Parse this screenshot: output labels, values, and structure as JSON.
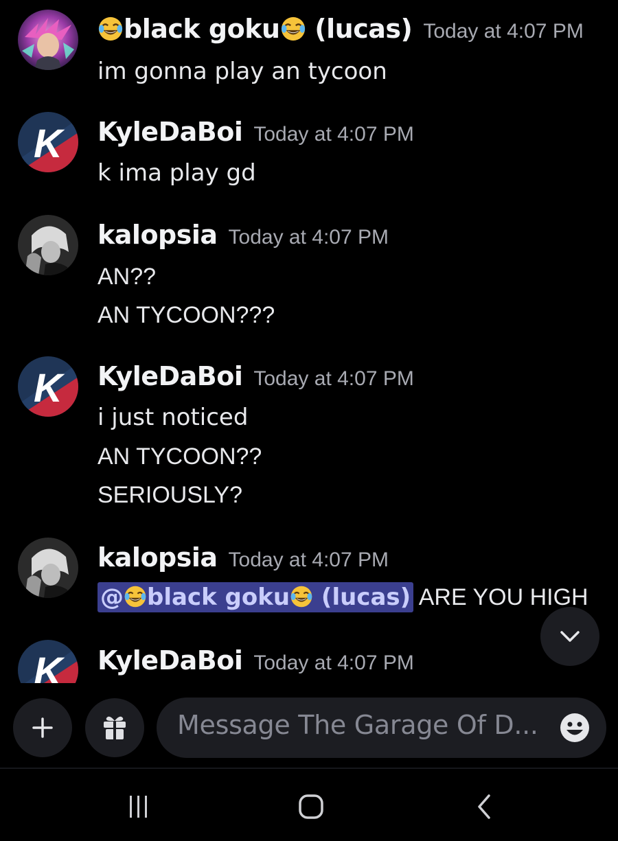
{
  "messages": [
    {
      "username_prefix": "",
      "username_main": "black goku",
      "username_suffix": " (lucas)",
      "timestamp": "Today at 4:07 PM",
      "lines": [
        "im gonna play an tycoon"
      ]
    },
    {
      "username": "KyleDaBoi",
      "timestamp": "Today at 4:07 PM",
      "lines": [
        "k ima play gd"
      ]
    },
    {
      "username": "kalopsia",
      "timestamp": "Today at 4:07 PM",
      "lines": [
        "AN??",
        "AN TYCOON???"
      ]
    },
    {
      "username": "KyleDaBoi",
      "timestamp": "Today at 4:07 PM",
      "lines": [
        "i just noticed",
        "AN TYCOON??",
        "SERIOUSLY?"
      ]
    },
    {
      "username": "kalopsia",
      "timestamp": "Today at 4:07 PM",
      "mention_at": "@",
      "mention_name": "black goku",
      "mention_suffix": " (lucas)",
      "lines": [
        " ARE YOU HIGH"
      ]
    },
    {
      "username": "KyleDaBoi",
      "timestamp": "Today at 4:07 PM"
    }
  ],
  "avatar_letter": "K",
  "composer": {
    "add_icon": "plus-icon",
    "gift_icon": "gift-icon",
    "placeholder": "Message The Garage Of D...",
    "emoji_icon": "smiley-face-icon"
  },
  "scroll_icon": "chevron-down-icon",
  "navbar": {
    "recent_apps_icon": "recent-apps-icon",
    "home_icon": "home-icon",
    "back_icon": "back-icon"
  },
  "colors": {
    "background": "#000000",
    "mention_bg": "#3b3f8f",
    "mention_text": "#c9cdfb",
    "timestamp": "#a8aab2",
    "surface": "#1c1d22"
  }
}
